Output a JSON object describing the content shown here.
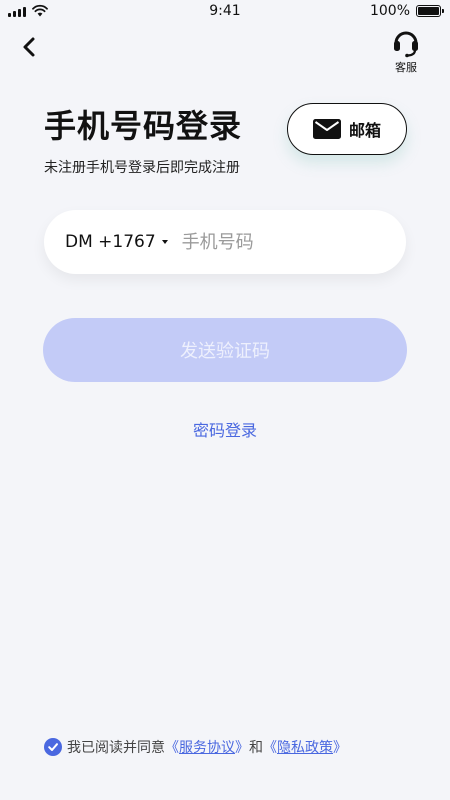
{
  "status_bar": {
    "time": "9:41",
    "battery_percent": "100%",
    "signal_icon": "cellular-signal-icon",
    "wifi_icon": "wifi-icon",
    "battery_icon": "battery-icon"
  },
  "nav": {
    "back_icon": "chevron-left-icon",
    "customer_service_icon": "headset-icon",
    "customer_service_label": "客服"
  },
  "header": {
    "title": "手机号码登录",
    "subtitle": "未注册手机号登录后即完成注册"
  },
  "email_login": {
    "icon": "envelope-icon",
    "label": "邮箱"
  },
  "phone_form": {
    "country_code": "DM +1767",
    "phone_value": "",
    "phone_placeholder": "手机号码",
    "send_code_label": "发送验证码",
    "password_login_label": "密码登录"
  },
  "agreement": {
    "checked": true,
    "prefix": "我已阅读并同意",
    "terms_open": "《",
    "terms_text": "服务协议",
    "terms_close": "》",
    "and": "和",
    "privacy_open": "《",
    "privacy_text": "隐私政策",
    "privacy_close": "》"
  },
  "colors": {
    "accent": "#4a68e0",
    "disabled_button": "#c3cbf7",
    "background": "#f4f5f9"
  }
}
